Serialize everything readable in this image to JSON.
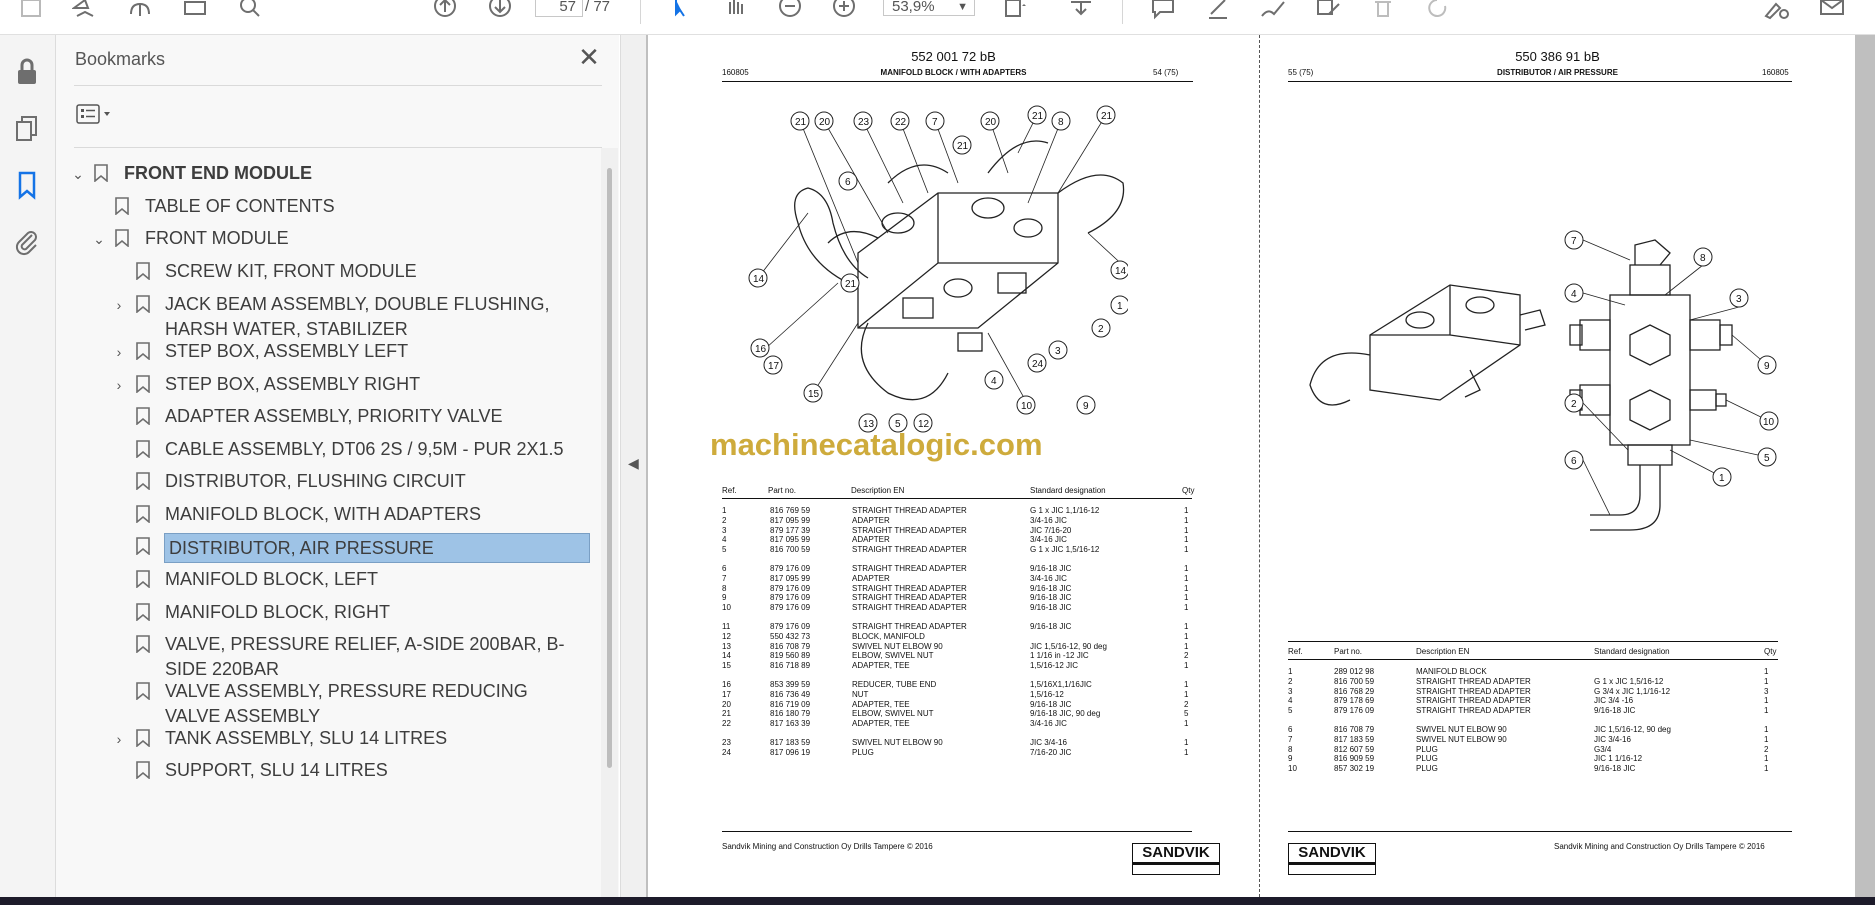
{
  "toolbar": {
    "page_current": "57",
    "page_sep_total": "/ 77",
    "zoom": "53,9%"
  },
  "bookmarks": {
    "title": "Bookmarks",
    "items": [
      {
        "label": "FRONT END MODULE"
      },
      {
        "label": "TABLE OF CONTENTS"
      },
      {
        "label": "FRONT MODULE"
      },
      {
        "label": "SCREW KIT, FRONT MODULE"
      },
      {
        "label": "JACK BEAM ASSEMBLY, DOUBLE FLUSHING, HARSH WATER, STABILIZER"
      },
      {
        "label": "STEP BOX, ASSEMBLY LEFT"
      },
      {
        "label": "STEP BOX, ASSEMBLY RIGHT"
      },
      {
        "label": "ADAPTER ASSEMBLY, PRIORITY VALVE"
      },
      {
        "label": "CABLE ASSEMBLY, DT06 2S / 9,5M - PUR 2X1.5"
      },
      {
        "label": "DISTRIBUTOR, FLUSHING CIRCUIT"
      },
      {
        "label": "MANIFOLD BLOCK, WITH ADAPTERS"
      },
      {
        "label": "DISTRIBUTOR, AIR PRESSURE"
      },
      {
        "label": "MANIFOLD BLOCK, LEFT"
      },
      {
        "label": "MANIFOLD BLOCK, RIGHT"
      },
      {
        "label": "VALVE, PRESSURE RELIEF, A-SIDE 200BAR, B-SIDE 220BAR"
      },
      {
        "label": "VALVE ASSEMBLY, PRESSURE REDUCING VALVE ASSEMBLY"
      },
      {
        "label": "TANK ASSEMBLY, SLU 14 LITRES"
      },
      {
        "label": "SUPPORT, SLU 14 LITRES"
      }
    ]
  },
  "left_page": {
    "docno": "552 001 72 bB",
    "code": "160805",
    "title": "MANIFOLD BLOCK / WITH ADAPTERS",
    "pageno": "54 (75)",
    "headers": [
      "Ref.",
      "Part no.",
      "Description EN",
      "Standard designation",
      "Qty"
    ],
    "rows": [
      [
        "1",
        "816 769 59",
        "STRAIGHT THREAD ADAPTER",
        "G 1 x JIC 1,1/16-12",
        "1"
      ],
      [
        "2",
        "817 095 99",
        "ADAPTER",
        "3/4-16 JIC",
        "1"
      ],
      [
        "3",
        "879 177 39",
        "STRAIGHT THREAD ADAPTER",
        "JIC 7/16-20",
        "1"
      ],
      [
        "4",
        "817 095 99",
        "ADAPTER",
        "3/4-16 JIC",
        "1"
      ],
      [
        "5",
        "816 700 59",
        "STRAIGHT THREAD ADAPTER",
        "G 1 x JIC 1,5/16-12",
        "1"
      ],
      [
        "6",
        "879 176 09",
        "STRAIGHT THREAD ADAPTER",
        "9/16-18 JIC",
        "1"
      ],
      [
        "7",
        "817 095 99",
        "ADAPTER",
        "3/4-16 JIC",
        "1"
      ],
      [
        "8",
        "879 176 09",
        "STRAIGHT THREAD ADAPTER",
        "9/16-18 JIC",
        "1"
      ],
      [
        "9",
        "879 176 09",
        "STRAIGHT THREAD ADAPTER",
        "9/16-18 JIC",
        "1"
      ],
      [
        "10",
        "879 176 09",
        "STRAIGHT THREAD ADAPTER",
        "9/16-18 JIC",
        "1"
      ],
      [
        "11",
        "879 176 09",
        "STRAIGHT THREAD ADAPTER",
        "9/16-18 JIC",
        "1"
      ],
      [
        "12",
        "550 432 73",
        "BLOCK, MANIFOLD",
        "",
        "1"
      ],
      [
        "13",
        "816 708 79",
        "SWIVEL NUT ELBOW 90",
        "JIC 1,5/16-12, 90 deg",
        "1"
      ],
      [
        "14",
        "819 560 89",
        "ELBOW, SWIVEL NUT",
        "1 1/16 in -12 JIC",
        "2"
      ],
      [
        "15",
        "816 718 89",
        "ADAPTER, TEE",
        "1,5/16-12 JIC",
        "1"
      ],
      [
        "16",
        "853 399 59",
        "REDUCER, TUBE END",
        "1,5/16X1,1/16JIC",
        "1"
      ],
      [
        "17",
        "816 736 49",
        "NUT",
        "1,5/16-12",
        "1"
      ],
      [
        "20",
        "816 719 09",
        "ADAPTER, TEE",
        "9/16-18 JIC",
        "2"
      ],
      [
        "21",
        "816 180 79",
        "ELBOW, SWIVEL NUT",
        "9/16-18 JIC, 90 deg",
        "5"
      ],
      [
        "22",
        "817 163 39",
        "ADAPTER, TEE",
        "3/4-16 JIC",
        "1"
      ],
      [
        "23",
        "817 183 59",
        "SWIVEL NUT ELBOW 90",
        "JIC 3/4-16",
        "1"
      ],
      [
        "24",
        "817 096 19",
        "PLUG",
        "7/16-20 JIC",
        "1"
      ]
    ],
    "footer": "Sandvik Mining and Construction Oy Drills Tampere © 2016",
    "callouts": [
      "21",
      "20",
      "23",
      "22",
      "7",
      "21",
      "20",
      "21",
      "8",
      "21",
      "6",
      "21",
      "14",
      "14",
      "16",
      "17",
      "15",
      "13",
      "5",
      "12",
      "10",
      "9",
      "24",
      "3",
      "4",
      "2",
      "1"
    ]
  },
  "right_page": {
    "docno": "550 386 91 bB",
    "code": "160805",
    "title": "DISTRIBUTOR / AIR PRESSURE",
    "pageno": "55 (75)",
    "headers": [
      "Ref.",
      "Part no.",
      "Description EN",
      "Standard designation",
      "Qty"
    ],
    "rows": [
      [
        "1",
        "289 012 98",
        "MANIFOLD BLOCK",
        "",
        "1"
      ],
      [
        "2",
        "816 700 59",
        "STRAIGHT THREAD ADAPTER",
        "G 1 x JIC 1,5/16-12",
        "1"
      ],
      [
        "3",
        "816 768 29",
        "STRAIGHT THREAD ADAPTER",
        "G 3/4 x JIC 1,1/16-12",
        "3"
      ],
      [
        "4",
        "879 178 69",
        "STRAIGHT THREAD ADAPTER",
        "JIC 3/4 -16",
        "1"
      ],
      [
        "5",
        "879 176 09",
        "STRAIGHT THREAD ADAPTER",
        "9/16-18 JIC",
        "1"
      ],
      [
        "6",
        "816 708 79",
        "SWIVEL NUT ELBOW 90",
        "JIC 1,5/16-12, 90 deg",
        "1"
      ],
      [
        "7",
        "817 183 59",
        "SWIVEL NUT ELBOW 90",
        "JIC 3/4-16",
        "1"
      ],
      [
        "8",
        "812 607 59",
        "PLUG",
        "G3/4",
        "2"
      ],
      [
        "9",
        "816 909 59",
        "PLUG",
        "JIC 1 1/16-12",
        "1"
      ],
      [
        "10",
        "857 302 19",
        "PLUG",
        "9/16-18 JIC",
        "1"
      ]
    ],
    "footer": "Sandvik Mining and Construction Oy Drills Tampere © 2016",
    "callouts": [
      "7",
      "8",
      "4",
      "3",
      "9",
      "10",
      "2",
      "5",
      "1",
      "6"
    ]
  },
  "brand_logo": "SANDVIK",
  "watermark": "machinecatalogic.com",
  "colors": {
    "selected_bookmark": "#9ec3e6",
    "watermark": "#c9a227",
    "accent_blue": "#1473e6"
  }
}
